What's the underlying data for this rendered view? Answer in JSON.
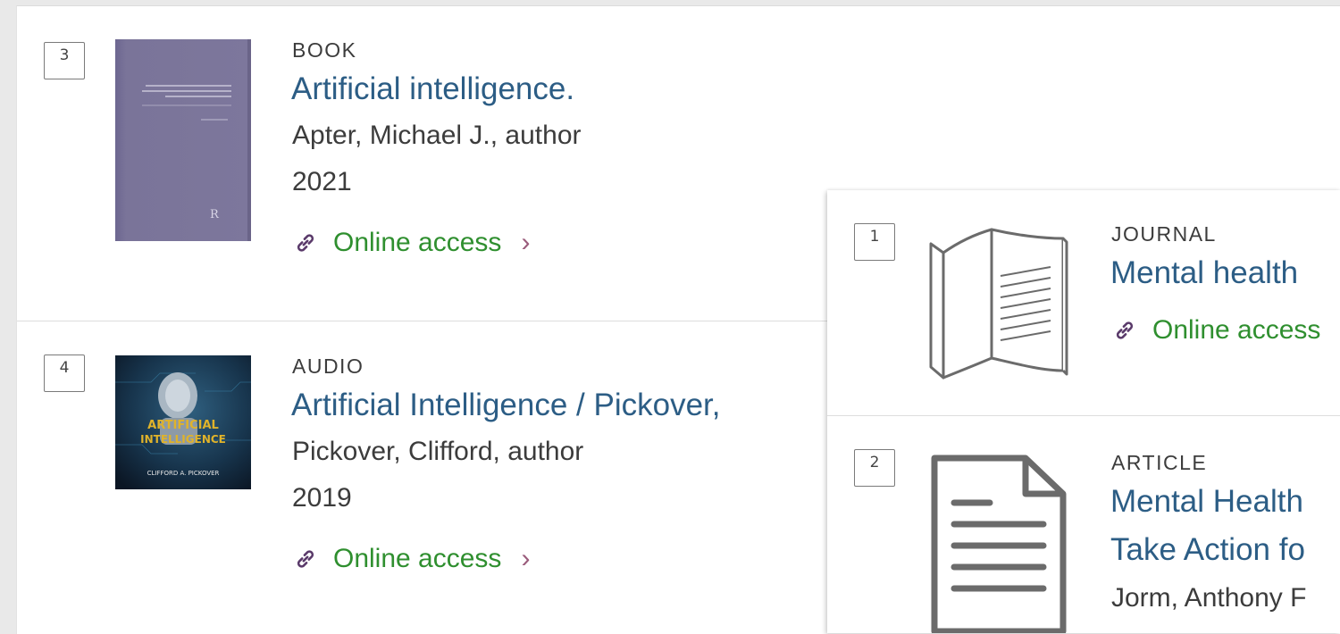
{
  "back_results": [
    {
      "number": "3",
      "type": "BOOK",
      "title": "Artificial intelligence.",
      "author": "Apter, Michael J., author",
      "year": "2021",
      "access": "Online access"
    },
    {
      "number": "4",
      "type": "AUDIO",
      "title": "Artificial Intelligence / Pickover,",
      "author": "Pickover, Clifford, author",
      "year": "2019",
      "access": "Online access",
      "cover": {
        "line1": "ARTIFICIAL",
        "line2": "INTELLIGENCE",
        "credit": "CLIFFORD A. PICKOVER"
      }
    }
  ],
  "front_results": [
    {
      "number": "1",
      "type": "JOURNAL",
      "title": "Mental health",
      "access": "Online access"
    },
    {
      "number": "2",
      "type": "ARTICLE",
      "title_line1": "Mental Health",
      "title_line2": "Take Action fo",
      "author": "Jorm, Anthony F"
    }
  ],
  "colors": {
    "title": "#2c5d85",
    "access": "#2f8f2f",
    "chevron": "#9a5b7b",
    "book_cover": "#7a7499"
  }
}
